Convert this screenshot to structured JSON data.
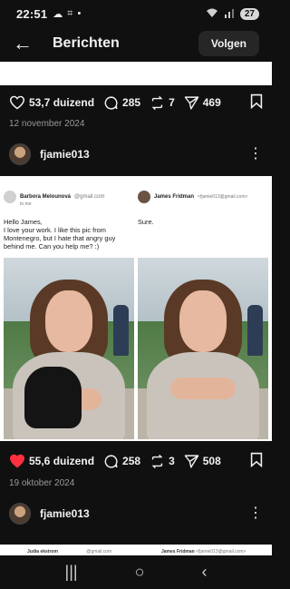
{
  "status": {
    "time": "22:51",
    "battery": "27"
  },
  "appbar": {
    "title": "Berichten",
    "follow": "Volgen"
  },
  "post1": {
    "likes": "53,7 duizend",
    "comments": "285",
    "reposts": "7",
    "shares": "469",
    "date": "12 november 2024"
  },
  "author1": {
    "handle": "fjamie013"
  },
  "post2": {
    "email_left": {
      "from": "Barbora Melounová",
      "email": "@gmail.com",
      "to": "to me",
      "body": "Hello James,\nI love your work. I like this pic from Montenegro, but I hate that angry guy behind me. Can you help me? :)"
    },
    "email_right": {
      "from": "James Fridman",
      "email": "<fjamie013@gmail.com>",
      "body": "Sure."
    },
    "likes": "55,6 duizend",
    "comments": "258",
    "reposts": "3",
    "shares": "508",
    "date": "19 oktober 2024"
  },
  "author2": {
    "handle": "fjamie013"
  },
  "post3_peek": {
    "left_from": "Judia ekstrom",
    "left_email": "@gmail.com",
    "right_from": "James Fridman",
    "right_email": "<fjamie013@gmail.com>"
  },
  "colors": {
    "like_active": "#ff3040",
    "bg": "#101010"
  },
  "icons": [
    "back-arrow-icon",
    "heart-icon",
    "comment-icon",
    "repost-icon",
    "share-icon",
    "bookmark-icon",
    "kebab-icon"
  ]
}
